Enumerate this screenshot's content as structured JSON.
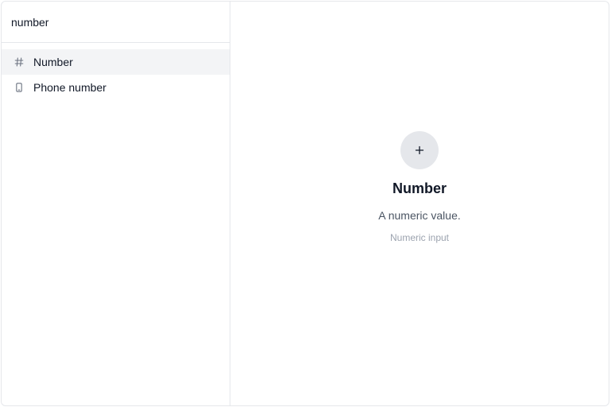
{
  "search": {
    "value": "number",
    "icon": "search-icon"
  },
  "results": [
    {
      "label": "Number",
      "icon": "hash-icon",
      "selected": true
    },
    {
      "label": "Phone number",
      "icon": "phone-icon",
      "selected": false
    }
  ],
  "preview": {
    "icon": "plus-icon",
    "title": "Number",
    "description": "A numeric value.",
    "hint": "Numeric input"
  },
  "colors": {
    "border": "#e5e7eb",
    "selected_bg": "#f3f4f6",
    "text": "#111827",
    "muted": "#4b5563",
    "faint": "#9ca3af"
  }
}
